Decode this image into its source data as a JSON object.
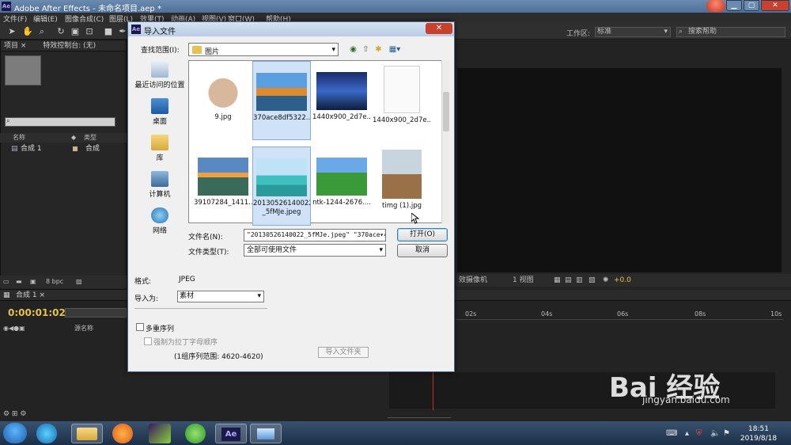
{
  "app": {
    "title": "Adobe After Effects - 未命名项目.aep *",
    "menu": [
      "文件(F)",
      "编辑(E)",
      "图像合成(C)",
      "图层(L)",
      "效果(T)",
      "动画(A)",
      "视图(V)",
      "窗口(W)",
      "帮助(H)"
    ],
    "workspace_label": "工作区:",
    "workspace_value": "标准",
    "search_help": "搜索帮助"
  },
  "project_panel": {
    "tab_project": "项目 ×",
    "tab_effects": "特效控制台: (无)",
    "col_name": "名称",
    "col_type": "类型",
    "row_name": "合成 1",
    "row_type": "合成",
    "bpc": "8 bpc"
  },
  "viewer": {
    "camera": "效摄像机",
    "views": "1 视图",
    "offset": "+0.0"
  },
  "timeline": {
    "tab": "合成 1 ×",
    "timecode": "0:00:01:02",
    "layer_name_col": "源名称",
    "ruler": [
      "02s",
      "04s",
      "06s",
      "08s",
      "10s"
    ]
  },
  "dialog": {
    "title": "导入文件",
    "look_in_label": "查找范围(I):",
    "look_in_value": "图片",
    "places": [
      {
        "label": "最近访问的位置"
      },
      {
        "label": "桌面"
      },
      {
        "label": "库"
      },
      {
        "label": "计算机"
      },
      {
        "label": "网络"
      }
    ],
    "files": [
      {
        "name": "9.jpg",
        "selected": false
      },
      {
        "name": "370ace8df5322...",
        "selected": true
      },
      {
        "name": "1440x900_2d7e...",
        "selected": false
      },
      {
        "name": "1440x900_2d7e...",
        "selected": false
      },
      {
        "name": "39107284_1411...",
        "selected": false
      },
      {
        "name": "20130526140022_5fMJe.jpeg",
        "name_line1": "20130526140022",
        "name_line2": "_5fMJe.jpeg",
        "selected": true
      },
      {
        "name": "ntk-1244-2676....",
        "selected": false
      },
      {
        "name": "timg (1).jpg",
        "selected": false
      }
    ],
    "filename_label": "文件名(N):",
    "filename_value": "\"20130526140022_5fMJe.jpeg\" \"370ace84",
    "filetype_label": "文件类型(T):",
    "filetype_value": "全部可使用文件",
    "open_button": "打开(O)",
    "cancel_button": "取消",
    "format_label": "格式:",
    "format_value": "JPEG",
    "import_as_label": "导入为:",
    "import_as_value": "素材",
    "sequence_label": "多重序列",
    "alpha_label": "强制为拉丁字母顺序",
    "range_label": "(1组序列范围: 4620-4620)",
    "import_folder_button": "导入文件夹"
  },
  "taskbar": {
    "time": "18:51",
    "date": "2019/8/18"
  },
  "watermark": {
    "brand": "Bai 经验",
    "url": "jingyan.baidu.com"
  }
}
